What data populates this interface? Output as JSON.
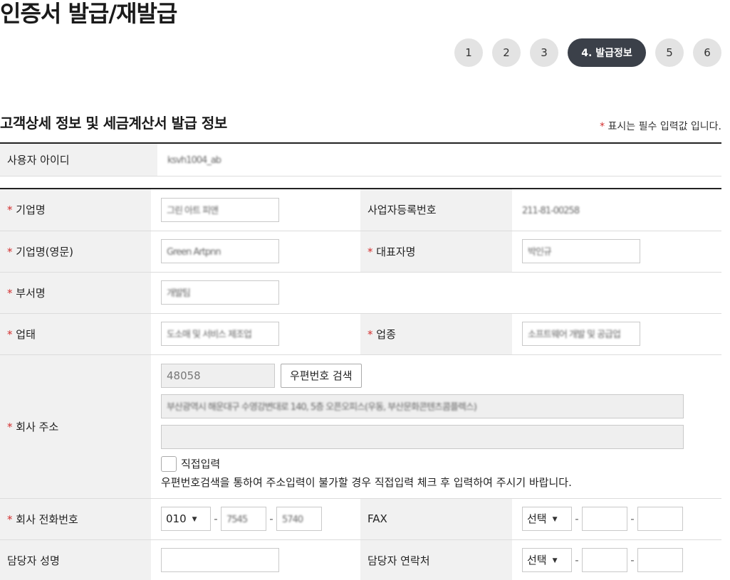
{
  "page": {
    "title": "인증서 발급/재발급"
  },
  "steps": [
    "1",
    "2",
    "3",
    "4. 발급정보",
    "5",
    "6"
  ],
  "section": {
    "title": "고객상세 정보 및 세금계산서 발급 정보",
    "required_note": "표시는 필수 입력값 입니다.",
    "required_mark": "*"
  },
  "user": {
    "label": "사용자 아이디",
    "value": "ksvh1004_ab"
  },
  "fields": {
    "company_name": {
      "label": "기업명",
      "value": "그린 아트 피앤"
    },
    "business_no": {
      "label": "사업자등록번호",
      "value": "211-81-00258"
    },
    "company_name_en": {
      "label": "기업명(영문)",
      "value": "Green Artpnn"
    },
    "ceo_name": {
      "label": "대표자명",
      "value": "박인규"
    },
    "department": {
      "label": "부서명",
      "value": "개발팀"
    },
    "business_type": {
      "label": "업태",
      "value": "도소매 및 서비스 제조업"
    },
    "business_item": {
      "label": "업종",
      "value": "소프트웨어 개발 및 공급업"
    },
    "address": {
      "label": "회사 주소",
      "zipcode": "48058",
      "zip_search_button": "우편번호 검색",
      "address1": "부산광역시 해운대구 수영강변대로 140, 5층 오픈오피스(우동, 부산문화콘텐츠콤플렉스)",
      "address2": "",
      "direct_input_label": "직접입력",
      "notice": "우편번호검색을 통하여 주소입력이 불가할 경우 직접입력 체크 후 입력하여 주시기 바랍니다."
    },
    "company_phone": {
      "label": "회사 전화번호",
      "prefix": "010",
      "middle": "7545",
      "last": "5740"
    },
    "fax": {
      "label": "FAX",
      "prefix": "선택",
      "middle": "",
      "last": ""
    },
    "manager_name": {
      "label": "담당자 성명",
      "value": ""
    },
    "manager_contact": {
      "label": "담당자 연락처",
      "prefix": "선택",
      "middle": "",
      "last": ""
    }
  },
  "colors": {
    "required": "#d32f2f",
    "active_step": "#3b4049",
    "header_bg": "#f1f1f1"
  }
}
